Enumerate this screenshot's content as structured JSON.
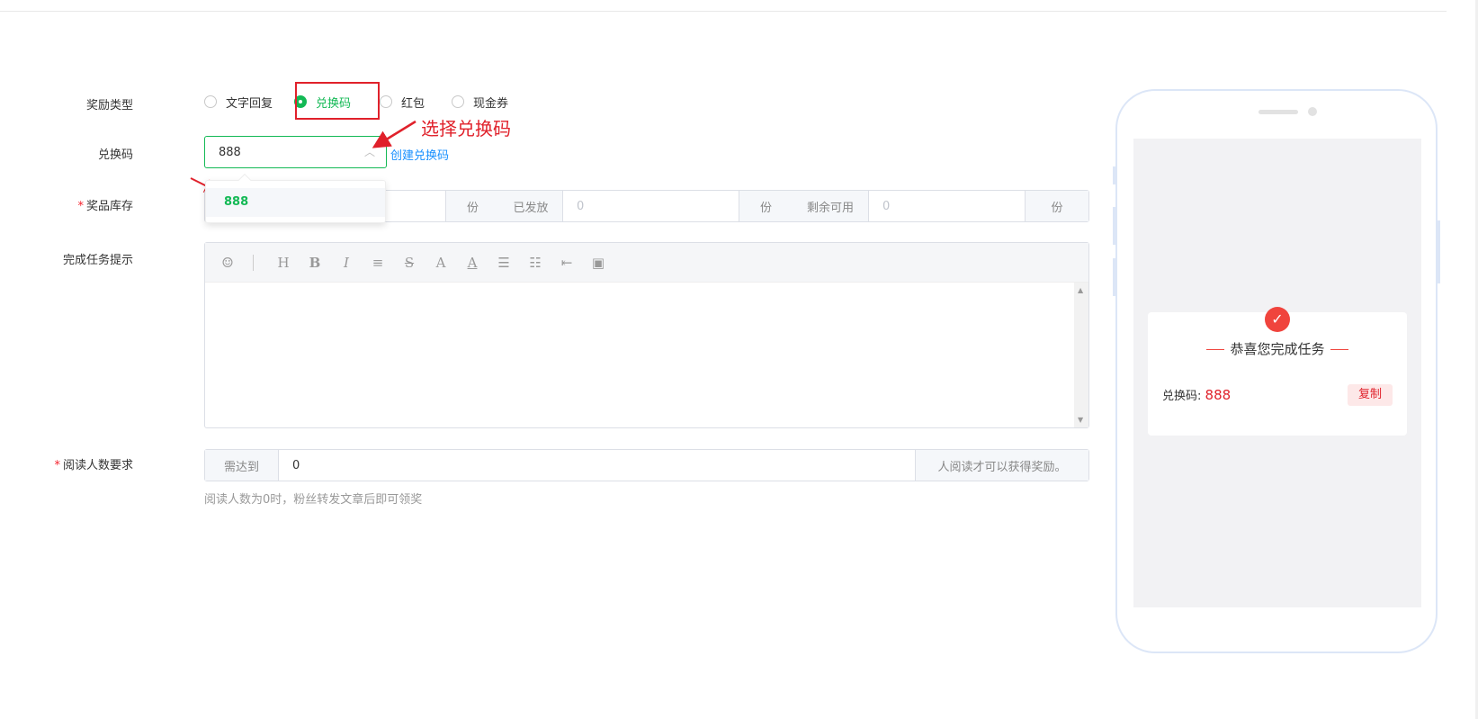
{
  "form": {
    "reward_type_label": "奖励类型",
    "reward_options": [
      "文字回复",
      "兑换码",
      "红包",
      "现金券"
    ],
    "code_label": "兑换码",
    "code_value": "888",
    "create_code_link": "创建兑换码",
    "dropdown_options": [
      "888"
    ],
    "stock_label": "奖品库存",
    "stock": {
      "unit1": "份",
      "issued_label": "已发放",
      "issued_value": "0",
      "unit2": "份",
      "remaining_label": "剩余可用",
      "remaining_value": "0",
      "unit3": "份"
    },
    "tip_label": "完成任务提示",
    "editor_tools": [
      "emoji-icon",
      "heading-icon",
      "bold-icon",
      "italic-icon",
      "align-icon",
      "strikethrough-icon",
      "font-color-icon",
      "bg-color-icon",
      "ordered-list-icon",
      "unordered-list-icon",
      "indent-icon",
      "image-icon"
    ],
    "read_label": "阅读人数要求",
    "read_prefix": "需达到",
    "read_value": "0",
    "read_suffix": "人阅读才可以获得奖励。",
    "read_hint": "阅读人数为0时，粉丝转发文章后即可领奖"
  },
  "annotation": {
    "text": "选择兑换码",
    "color": "#e0212b"
  },
  "preview": {
    "title": "恭喜您完成任务",
    "code_label": "兑换码:",
    "code_value": "888",
    "copy_label": "复制"
  },
  "colors": {
    "accent": "#13b955",
    "link": "#1890ff",
    "alert": "#e0212b"
  }
}
